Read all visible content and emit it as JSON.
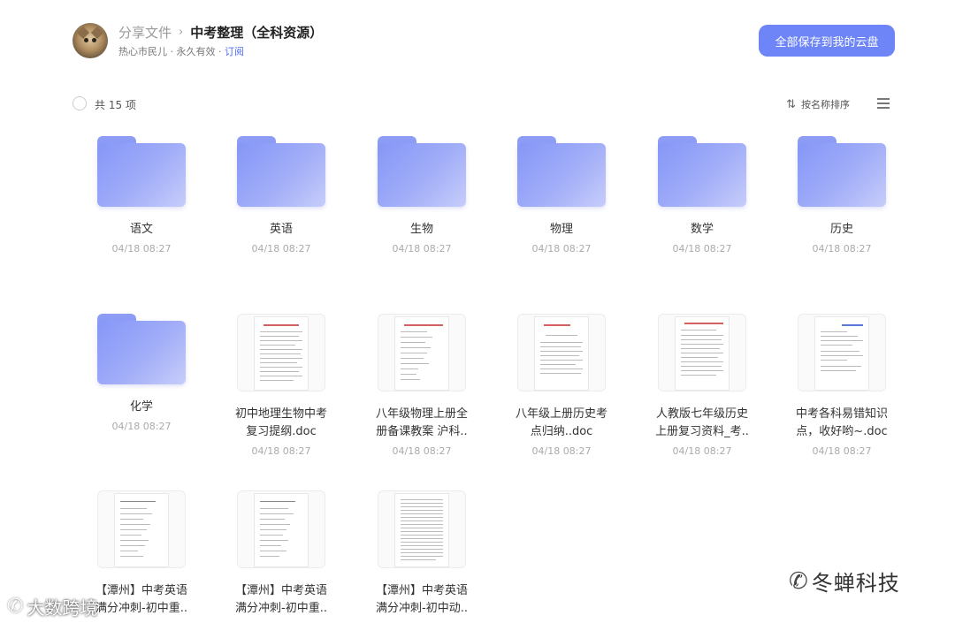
{
  "header": {
    "parent": "分享文件",
    "separator": "›",
    "title": "中考整理（全科资源）",
    "sharer": "热心市民儿",
    "validity": "永久有效",
    "dot": "·",
    "subscribe": "订阅",
    "save_all": "全部保存到我的云盘"
  },
  "toolbar": {
    "count": "共 15 项",
    "sort": "按名称排序"
  },
  "items": [
    {
      "name": "语文",
      "date": "04/18 08:27",
      "type": "folder"
    },
    {
      "name": "英语",
      "date": "04/18 08:27",
      "type": "folder"
    },
    {
      "name": "生物",
      "date": "04/18 08:27",
      "type": "folder"
    },
    {
      "name": "物理",
      "date": "04/18 08:27",
      "type": "folder"
    },
    {
      "name": "数学",
      "date": "04/18 08:27",
      "type": "folder"
    },
    {
      "name": "历史",
      "date": "04/18 08:27",
      "type": "folder"
    },
    {
      "name": "化学",
      "date": "04/18 08:27",
      "type": "folder"
    },
    {
      "name_l1": "初中地理生物中考",
      "name_l2": "复习提纲.doc",
      "date": "04/18 08:27",
      "type": "doc"
    },
    {
      "name_l1": "八年级物理上册全",
      "name_l2": "册备课教案 沪科..",
      "date": "04/18 08:27",
      "type": "doc"
    },
    {
      "name_l1": "八年级上册历史考",
      "name_l2": "点归纳..doc",
      "date": "04/18 08:27",
      "type": "doc"
    },
    {
      "name_l1": "人教版七年级历史",
      "name_l2": "上册复习资料_考..",
      "date": "04/18 08:27",
      "type": "doc"
    },
    {
      "name_l1": "中考各科易错知识",
      "name_l2": "点，收好哟~.doc",
      "date": "04/18 08:27",
      "type": "doc"
    },
    {
      "name_l1": "【潭州】中考英语",
      "name_l2": "满分冲刺-初中重..",
      "type": "doc"
    },
    {
      "name_l1": "【潭州】中考英语",
      "name_l2": "满分冲刺-初中重..",
      "type": "doc"
    },
    {
      "name_l1": "【潭州】中考英语",
      "name_l2": "满分冲刺-初中动..",
      "type": "doc"
    }
  ],
  "watermarks": {
    "brand": "冬蝉科技",
    "brand2": "大数跨境"
  },
  "colors": {
    "accent": "#6d85f6",
    "link": "#4f6ef7"
  }
}
